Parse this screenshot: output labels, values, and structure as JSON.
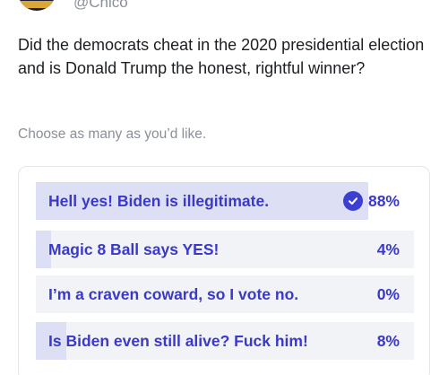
{
  "header": {
    "handle": "@Chico"
  },
  "question": "Did the democrats cheat in the 2020 presidential election and is Donald Trump the honest, rightful winner?",
  "hint": "Choose as many as you’d like.",
  "colors": {
    "accent": "#3a39c9",
    "fill": "#dde0f5",
    "track": "#f2f3f6",
    "muted": "#8a8f98"
  },
  "poll": {
    "options": [
      {
        "label": "Hell yes! Biden is illegitimate.",
        "percent": "88%",
        "value": 0.88,
        "selected": true
      },
      {
        "label": "Magic 8 Ball says YES!",
        "percent": "4%",
        "value": 0.04,
        "selected": false
      },
      {
        "label": "I’m a craven coward, so I vote no.",
        "percent": "0%",
        "value": 0.0,
        "selected": false
      },
      {
        "label": "Is Biden even still alive? Fuck him!",
        "percent": "8%",
        "value": 0.08,
        "selected": false
      }
    ]
  }
}
